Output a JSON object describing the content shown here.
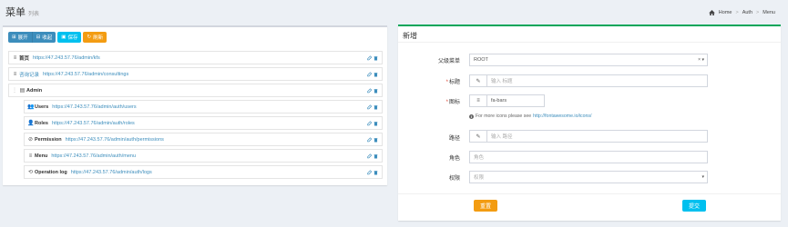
{
  "header": {
    "title": "菜单",
    "subtitle": "列表",
    "breadcrumb": [
      "Home",
      "Auth",
      "Menu"
    ]
  },
  "toolbar": {
    "expand_label": "展开",
    "collapse_label": "收起",
    "save_label": "保存",
    "refresh_label": "刷新"
  },
  "tree": {
    "items": [
      {
        "title": "首页",
        "uri": "https://47.243.57.76/admin/kfs",
        "icon": "bars-icon",
        "level": 0
      },
      {
        "title": "咨询记录",
        "uri": "https://47.243.57.76/admin/consultings",
        "icon": "bars-icon",
        "level": 0
      },
      {
        "title": "Admin",
        "uri": "",
        "icon": "tasks-icon",
        "level": 0
      },
      {
        "title": "Users",
        "uri": "https://47.243.57.76/admin/auth/users",
        "icon": "users-icon",
        "level": 1
      },
      {
        "title": "Roles",
        "uri": "https://47.243.57.76/admin/auth/roles",
        "icon": "user-icon",
        "level": 1
      },
      {
        "title": "Permission",
        "uri": "https://47.243.57.76/admin/auth/permissions",
        "icon": "ban-icon",
        "level": 1
      },
      {
        "title": "Menu",
        "uri": "https://47.243.57.76/admin/auth/menu",
        "icon": "bars-icon",
        "level": 1
      },
      {
        "title": "Operation log",
        "uri": "https://47.243.57.76/admin/auth/logs",
        "icon": "history-icon",
        "level": 1
      }
    ]
  },
  "form": {
    "title": "新增",
    "parent_label": "父级菜单",
    "parent_value": "ROOT",
    "title_label": "标题",
    "title_placeholder": "输入 标题",
    "icon_label": "图标",
    "icon_value": "fa-bars",
    "help_text": "For more icons please see",
    "help_link": "http://fontawesome.io/icons/",
    "path_label": "路径",
    "path_placeholder": "输入 路径",
    "role_label": "角色",
    "role_placeholder": "角色",
    "perm_label": "权限",
    "perm_placeholder": "权限",
    "reset_label": "重置",
    "submit_label": "提交"
  },
  "colors": {
    "primary": "#3c8dbc",
    "info": "#00c0ef",
    "warning": "#f39c12",
    "success": "#00a65a",
    "danger": "#dd4b39"
  }
}
